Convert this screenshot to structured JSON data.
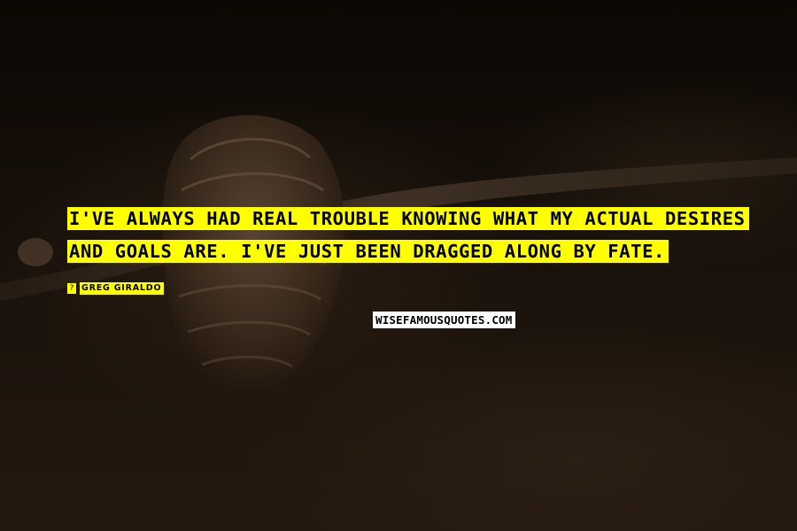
{
  "quote": {
    "line1": "I've always had real trouble knowing what my actual desires",
    "line2": "and goals are. I've just been dragged along by fate."
  },
  "author": {
    "icon": "dash-icon",
    "icon_glyph": "?",
    "name": "Greg Giraldo"
  },
  "watermark": {
    "text": "WISEFAMOUSQUOTES.COM"
  },
  "colors": {
    "highlight": "#ffff00",
    "text": "#000000",
    "watermark_bg": "#ffffff",
    "background": "#120c07"
  }
}
